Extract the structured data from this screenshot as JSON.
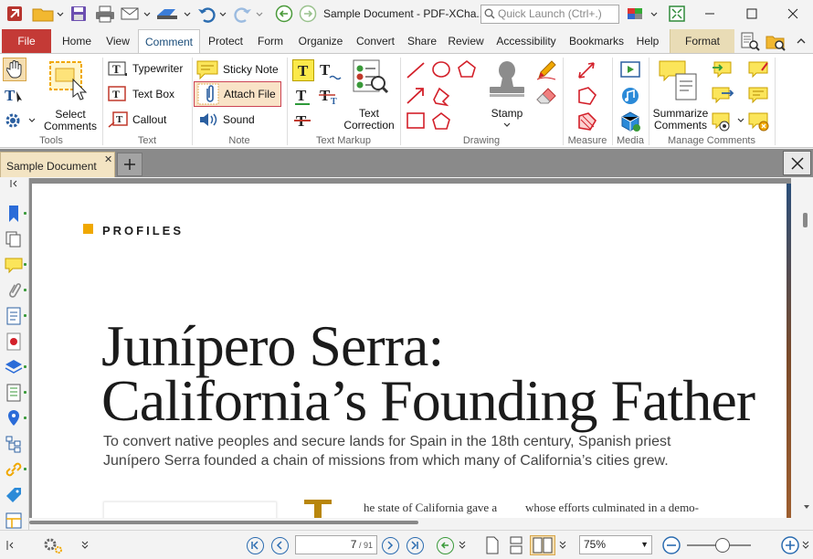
{
  "window": {
    "title": "Sample Document - PDF-XCha..",
    "quick_launch_placeholder": "Quick Launch (Ctrl+.)"
  },
  "ribbon_tabs": [
    "File",
    "Home",
    "View",
    "Comment",
    "Protect",
    "Form",
    "Organize",
    "Convert",
    "Share",
    "Review",
    "Accessibility",
    "Bookmarks",
    "Help",
    "Format"
  ],
  "ribbon": {
    "tools": {
      "select_comments_line1": "Select",
      "select_comments_line2": "Comments",
      "group": "Tools"
    },
    "text": {
      "typewriter": "Typewriter",
      "text_box": "Text Box",
      "callout": "Callout",
      "group": "Text"
    },
    "note": {
      "sticky_note": "Sticky Note",
      "attach_file": "Attach File",
      "sound": "Sound",
      "group": "Note"
    },
    "text_markup": {
      "text_correction_line1": "Text",
      "text_correction_line2": "Correction",
      "group": "Text Markup"
    },
    "drawing": {
      "stamp": "Stamp",
      "group": "Drawing"
    },
    "measure": {
      "group": "Measure"
    },
    "media": {
      "group": "Media"
    },
    "manage": {
      "summarize_line1": "Summarize",
      "summarize_line2": "Comments",
      "group": "Manage Comments"
    }
  },
  "doc_tab": {
    "label": "Sample Document"
  },
  "page": {
    "section_label": "PROFILES",
    "headline_line1": "Junípero Serra:",
    "headline_line2": "California’s Founding Father",
    "deck_line1": "To convert native peoples and secure lands for Spain in the 18th century, Spanish priest",
    "deck_line2": "Junípero Serra founded a chain of missions from which many of California’s cities grew.",
    "body_col1": "he state of California gave a",
    "body_col2": "whose efforts culminated in a demo-"
  },
  "statusbar": {
    "page_current": "7",
    "page_total": "91",
    "zoom": "75%"
  },
  "colors": {
    "accent": "#f0a800",
    "file_tab": "#c43a36",
    "comment_tab_text": "#1a4d7a",
    "format_tab": "#e9dcb6",
    "doc_tab": "#f3e4c3"
  }
}
